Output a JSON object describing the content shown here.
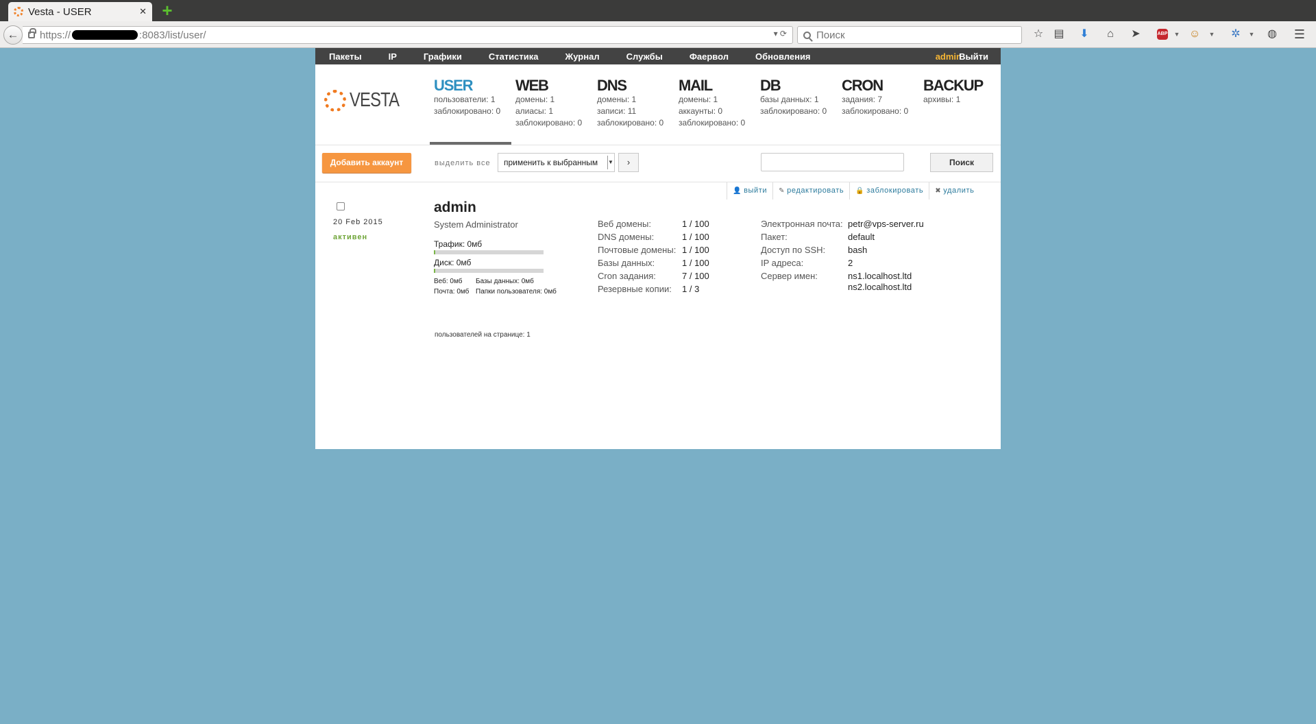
{
  "browser": {
    "tab_title": "Vesta - USER",
    "url_prefix": "https://",
    "url_suffix": ":8083/list/user/",
    "search_placeholder": "Поиск",
    "icons": [
      "bookmark-star-icon",
      "reading-list-icon",
      "downloads-icon",
      "home-icon",
      "send-icon",
      "adblock-icon",
      "emoji-icon",
      "extension-icon",
      "chat-icon",
      "menu-icon"
    ]
  },
  "topmenu": {
    "items": [
      "Пакеты",
      "IP",
      "Графики",
      "Статистика",
      "Журнал",
      "Службы",
      "Фаервол",
      "Обновления"
    ],
    "user": "admin",
    "logout": "Выйти"
  },
  "logo": {
    "text": "VESTA",
    "accent": "#f07a20"
  },
  "sections": [
    {
      "title": "USER",
      "lines": [
        "пользователи: 1",
        "заблокировано: 0"
      ]
    },
    {
      "title": "WEB",
      "lines": [
        "домены: 1",
        "алиасы: 1",
        "заблокировано: 0"
      ]
    },
    {
      "title": "DNS",
      "lines": [
        "домены: 1",
        "записи: 11",
        "заблокировано: 0"
      ]
    },
    {
      "title": "MAIL",
      "lines": [
        "домены: 1",
        "аккаунты: 0",
        "заблокировано: 0"
      ]
    },
    {
      "title": "DB",
      "lines": [
        "базы данных: 1",
        "заблокировано: 0"
      ]
    },
    {
      "title": "CRON",
      "lines": [
        "задания: 7",
        "заблокировано: 0"
      ]
    },
    {
      "title": "BACKUP",
      "lines": [
        "архивы: 1"
      ]
    }
  ],
  "toolbar": {
    "add_label": "Добавить аккаунт",
    "select_all": "выделить все",
    "bulk_action": "применить к выбранным",
    "go": "›",
    "search_label": "Поиск",
    "search_value": ""
  },
  "row_actions": {
    "login": "выйти",
    "edit": "редактировать",
    "suspend": "заблокировать",
    "delete": "удалить"
  },
  "user": {
    "date": "20 Feb 2015",
    "status": "активен",
    "name": "admin",
    "full_name": "System Administrator",
    "traffic": "Трафик: 0мб",
    "disk": "Диск: 0мб",
    "traffic_fraction": 0.0,
    "disk_fraction": 0.0,
    "web_usage": "Веб: 0мб",
    "db_usage": "Базы данных: 0мб",
    "mail_usage": "Почта: 0мб",
    "dirs_usage": "Папки пользователя: 0мб",
    "stats_labels": [
      "Веб домены:",
      "DNS домены:",
      "Почтовые домены:",
      "Базы данных:",
      "Cron задания:",
      "Резервные копии:"
    ],
    "stats_values": [
      "1 / 100",
      "1 / 100",
      "1 / 100",
      "1 / 100",
      "7 / 100",
      "1 / 3"
    ],
    "info_labels": [
      "Электронная почта:",
      "Пакет:",
      "Доступ по SSH:",
      "IP адреса:",
      "Сервер имен:"
    ],
    "info_values": [
      "petr@vps-server.ru",
      "default",
      "bash",
      "2",
      "ns1.localhost.ltd"
    ],
    "ns2": "ns2.localhost.ltd"
  },
  "footer": {
    "per_page": "пользователей на странице: 1"
  },
  "colors": {
    "background": "#7aafc6",
    "active_section": "#2d8fc0",
    "add_button": "#f69640",
    "status_active": "#6fa538",
    "admin_link": "#f6b634"
  }
}
